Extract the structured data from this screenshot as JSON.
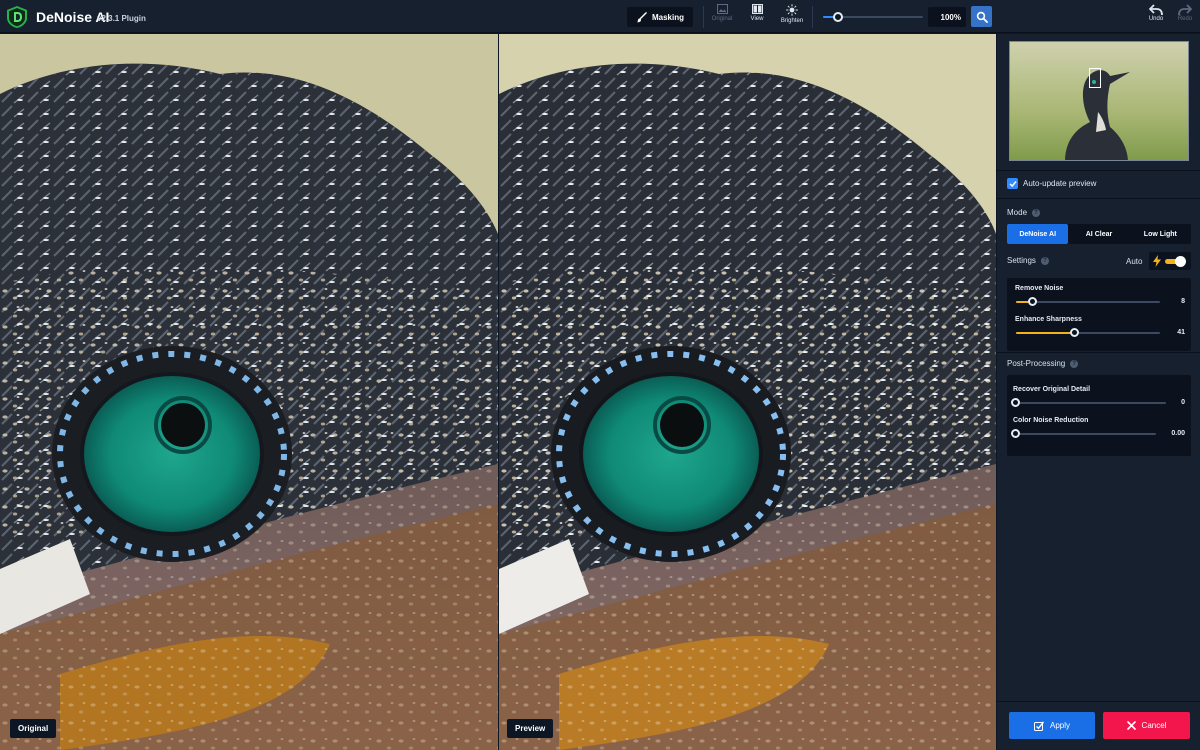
{
  "app": {
    "name": "DeNoise AI",
    "version": "v2.3.1 Plugin"
  },
  "toolbar": {
    "masking_label": "Masking",
    "original_label": "Original",
    "view_label": "View",
    "brighten_label": "Brighten",
    "zoom_level": 0.15,
    "zoom_value": "100%",
    "undo_label": "Undo",
    "redo_label": "Redo"
  },
  "panes": {
    "left_label": "Original",
    "right_label": "Preview"
  },
  "panel": {
    "auto_update_label": "Auto-update preview",
    "auto_update_checked": true,
    "mode_title": "Mode",
    "mode_help": "?",
    "modes": [
      {
        "label": "DeNoise AI",
        "active": true
      },
      {
        "label": "AI Clear",
        "active": false
      },
      {
        "label": "Low Light",
        "active": false
      }
    ],
    "settings_title": "Settings",
    "settings_help": "?",
    "auto_label": "Auto",
    "auto_enabled": true,
    "remove_noise": {
      "label": "Remove Noise",
      "value": "8",
      "level": 0.12
    },
    "enhance_sharpness": {
      "label": "Enhance Sharpness",
      "value": "41",
      "level": 0.41
    },
    "post_title": "Post-Processing",
    "post_help": "?",
    "recover_detail": {
      "label": "Recover Original Detail",
      "value": "0",
      "level": 0
    },
    "color_noise": {
      "label": "Color Noise Reduction",
      "value": "0.00",
      "level": 0
    }
  },
  "actions": {
    "apply_label": "Apply",
    "cancel_label": "Cancel"
  },
  "colors": {
    "accent_blue": "#1a6fe6",
    "accent_yellow": "#f3b21c",
    "cancel_red": "#f2164d",
    "eye_teal": "#0f8a76"
  }
}
